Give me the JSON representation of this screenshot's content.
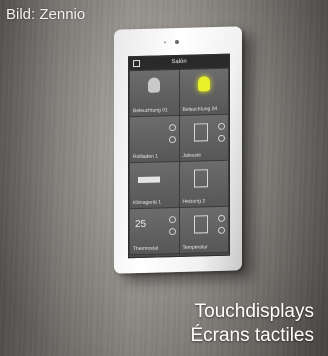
{
  "credit": "Bild: Zennio",
  "caption": {
    "line1": "Touchdisplays",
    "line2": "Écrans tactiles"
  },
  "device": {
    "screen_title": "Salón",
    "tiles": [
      {
        "label": "Beleuchtung 01",
        "icon": "lightbulb-icon",
        "state": "off"
      },
      {
        "label": "Beleuchtung 04",
        "icon": "lightbulb-icon",
        "state": "on"
      },
      {
        "label": "Rollladen 1",
        "icon": "blinds-icon"
      },
      {
        "label": "Jalousie",
        "icon": "shutter-icon"
      },
      {
        "label": "Klimagerät 1",
        "icon": "ac-unit-icon"
      },
      {
        "label": "Heizung 2",
        "icon": "radiator-icon"
      },
      {
        "label": "Thermostat",
        "icon": "thermometer-icon",
        "value": "25"
      },
      {
        "label": "Temperatur",
        "icon": "thermometer-icon"
      }
    ]
  }
}
